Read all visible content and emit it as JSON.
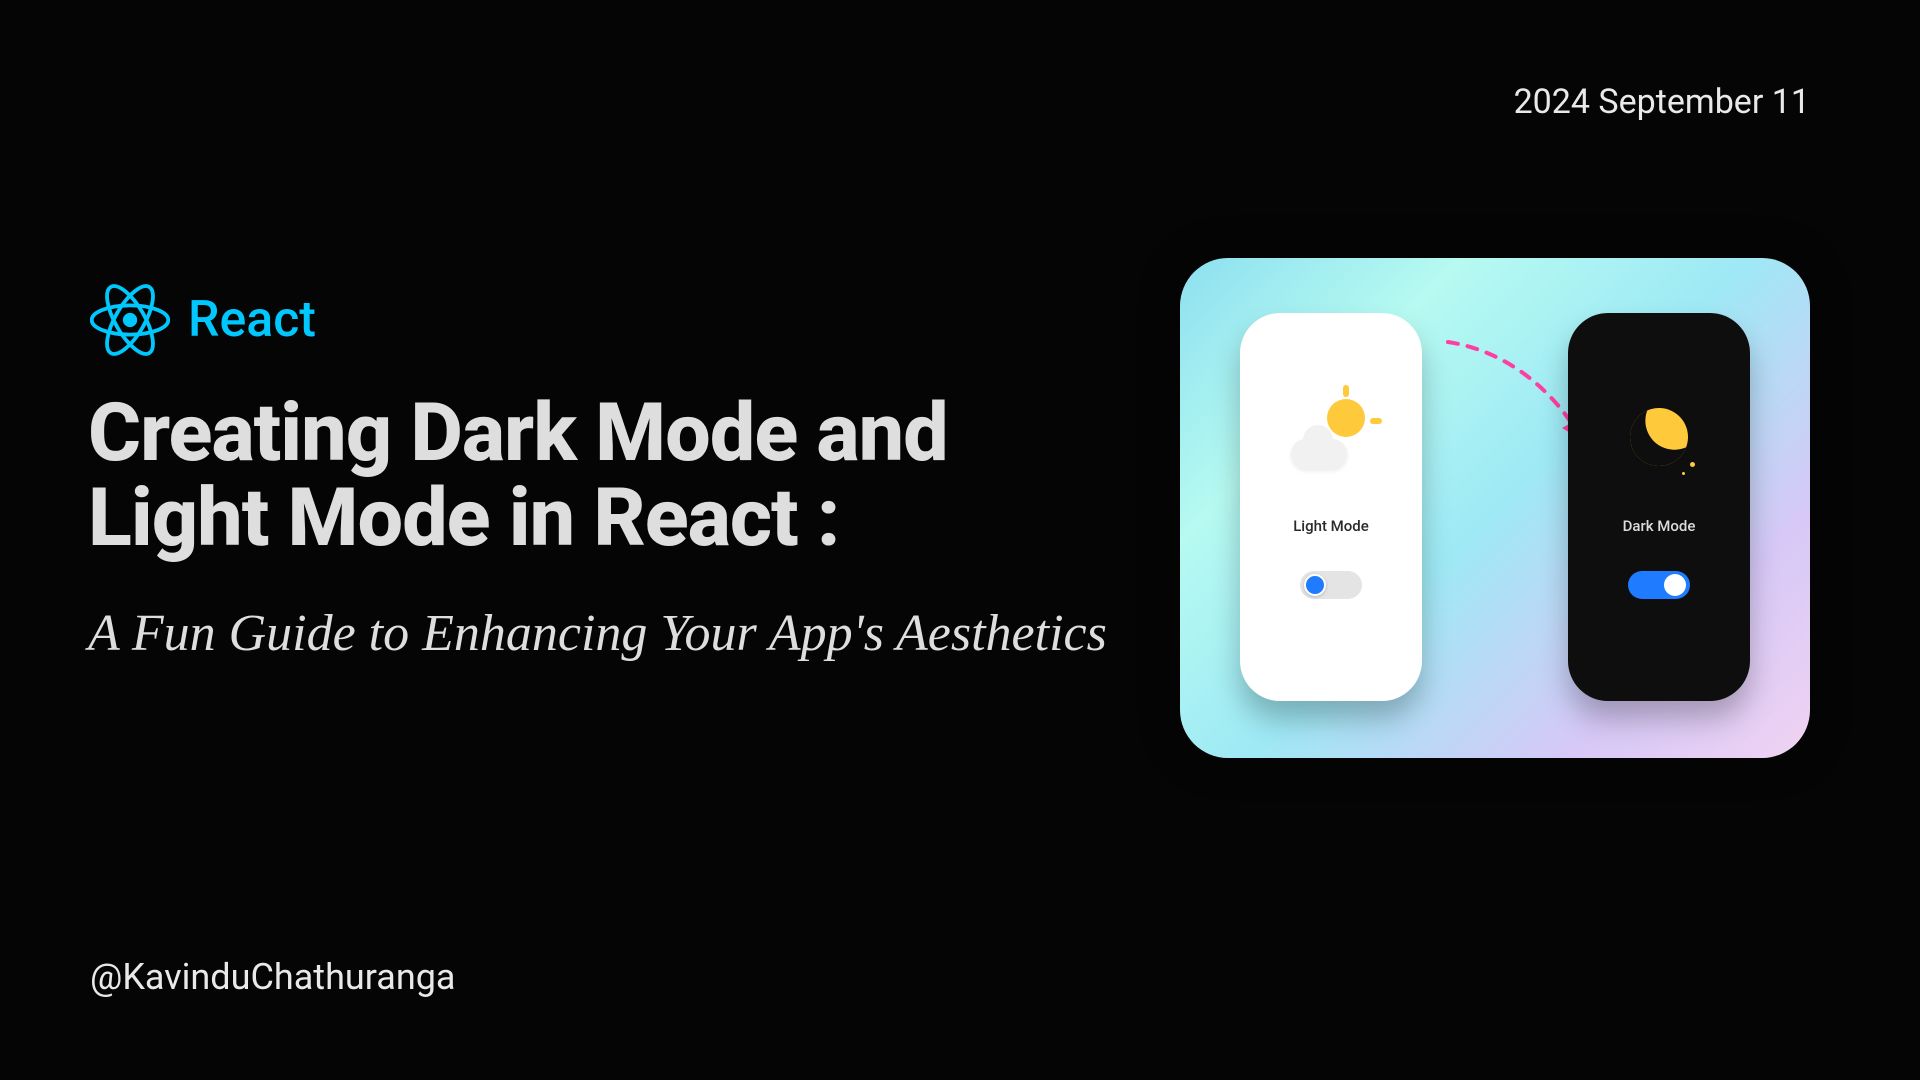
{
  "date": "2024 September 11",
  "react_label": "React",
  "title": "Creating Dark Mode and Light Mode in React :",
  "subtitle": "A Fun Guide to Enhancing Your App's Aesthetics",
  "author": "@KavinduChathuranga",
  "illustration": {
    "light_phone_label": "Light Mode",
    "dark_phone_label": "Dark Mode"
  },
  "colors": {
    "background": "#050505",
    "text": "#dedede",
    "react_cyan": "#00c8ff",
    "arrow_pink": "#ff3ea1",
    "toggle_blue": "#1f7bff",
    "sun_yellow": "#ffc93c"
  }
}
